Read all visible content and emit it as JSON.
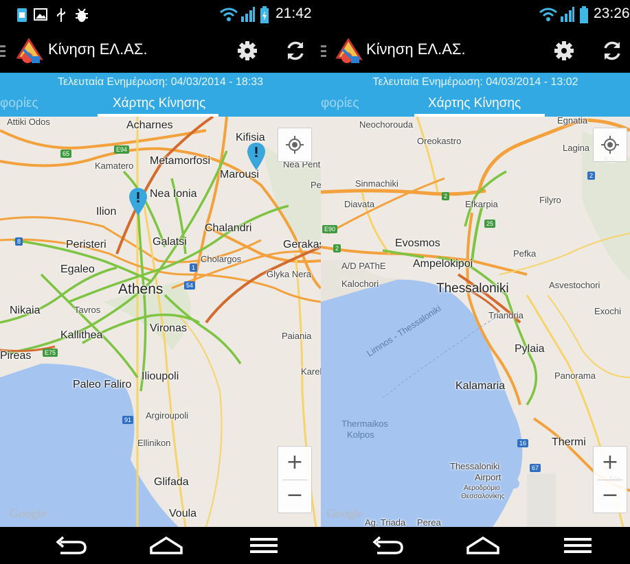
{
  "screens": [
    {
      "status_time": "21:42",
      "app_title": "Κίνηση ΕΛ.ΑΣ.",
      "last_update": "Τελευταία Ενημέρωση: 04/03/2014 - 18:33",
      "tab_prev": "φορίες",
      "tab_active": "Χάρτης Κίνησης",
      "map_labels": {
        "attiki_odos": "Attiki Odos",
        "acharnes": "Acharnes",
        "kifisia": "Kifisia",
        "kamatero": "Kamatero",
        "metamorfosi": "Metamorfosi",
        "marousi": "Marousi",
        "nea_pent": "Nea Pent",
        "per": "Per",
        "nea_ionia": "Nea Ionia",
        "ilion": "Ilion",
        "chalandri": "Chalandri",
        "peristeri": "Peristeri",
        "galatsi": "Galatsi",
        "gerakas": "Gerakas",
        "cholargos": "Cholargos",
        "egaleo": "Egaleo",
        "glyka_nera": "Glyka Nera",
        "athens": "Athens",
        "nikaia": "Nikaia",
        "tavros": "Tavros",
        "vironas": "Vironas",
        "kallithea": "Kallithea",
        "paiania": "Paiania",
        "pireas": "Pireas",
        "karell": "Karell",
        "paleo_faliro": "Paleo Faliro",
        "ilioupoli": "Ilioupoli",
        "argiroupoli": "Argiroupoli",
        "ellinikon": "Ellinikon",
        "glifada": "Glifada",
        "voula": "Voula",
        "google": "Google"
      },
      "shields": {
        "s65": "65",
        "e94": "E94",
        "s8": "8",
        "s1": "1",
        "s54": "54",
        "e75": "E75",
        "s91": "91"
      }
    },
    {
      "status_time": "23:26",
      "app_title": "Κίνηση ΕΛ.ΑΣ.",
      "last_update": "Τελευταία Ενημέρωση: 04/03/2014 - 13:02",
      "tab_prev": "φορίες",
      "tab_active": "Χάρτης Κίνησης",
      "map_labels": {
        "neochorouda": "Neochorouda",
        "gnatia": "Egnatia",
        "oreokastro": "Oreokastro",
        "lagina": "Lagina",
        "ka": "Ka",
        "sinmachiki": "Sinmachiki",
        "diavata": "Diavata",
        "efkarpia": "Efkarpia",
        "filyro": "Filyro",
        "evosmos": "Evosmos",
        "pefka": "Pefka",
        "adpathe": "A/D PAThE",
        "ampelokipoi": "Ampelokipoi",
        "kalochori": "Kalochori",
        "thessaloniki": "Thessaloniki",
        "asvestochori": "Asvestochori",
        "exochi": "Exochi",
        "triandria": "Triandria",
        "pylaia": "Pylaia",
        "limnos": "Limnos - Thessaloniki",
        "panorama": "Panorama",
        "kalamaria": "Kalamaria",
        "thermaikos": "Thermaikos",
        "kolpos": "Kolpos",
        "thermi": "Thermi",
        "airport1": "Thessaloniki",
        "airport2": "Airport",
        "airport_gr1": "Αεροδρόμιο",
        "airport_gr2": "Θεσσαλονίκης",
        "ne": "Ne",
        "ag_triada": "Ag. Triada",
        "perea": "Perea",
        "google": "Google"
      },
      "shields": {
        "s2a": "2",
        "e90": "E90",
        "s2b": "2",
        "s2c": "2",
        "s25": "25",
        "s16": "16",
        "s67": "67",
        "s2d": "2"
      }
    }
  ],
  "icons": [
    "sim-icon",
    "image-icon",
    "usb-icon",
    "debug-icon",
    "wifi-icon",
    "signal-icon",
    "battery-icon",
    "drawer-icon",
    "app-logo-icon",
    "settings-icon",
    "refresh-icon",
    "my-location-icon",
    "zoom-in-icon",
    "zoom-out-icon",
    "back-icon",
    "home-icon",
    "menu-icon",
    "map-pin-icon"
  ],
  "colors": {
    "actionbar": "#000000",
    "tabbar": "#33a9e3",
    "water": "#a5c5f0",
    "land": "#eeeae3",
    "motorway": "#f3a13c",
    "traffic_green": "#7cc442"
  }
}
